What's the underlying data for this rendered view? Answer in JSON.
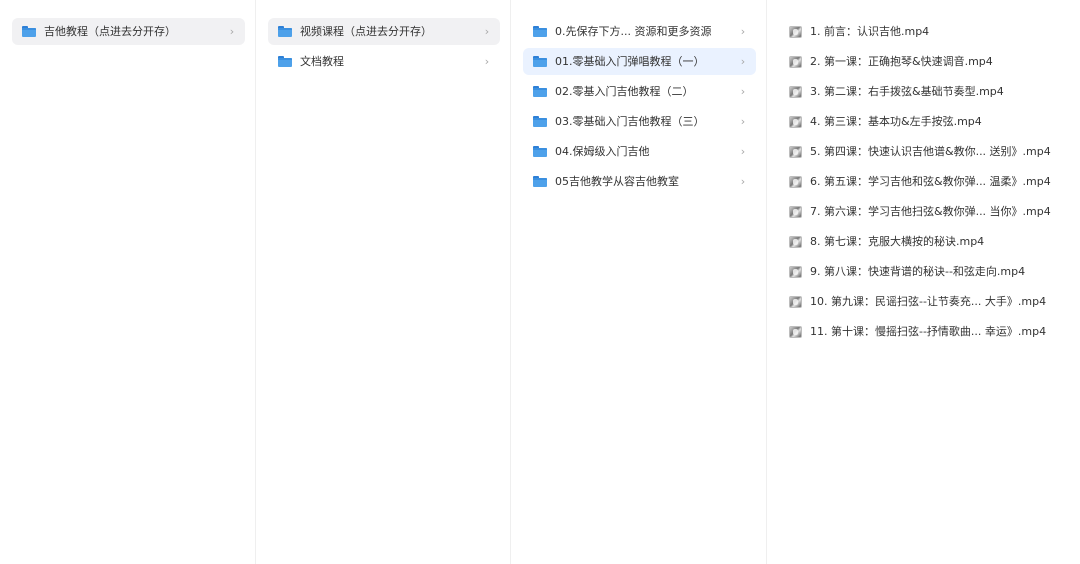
{
  "columns": [
    {
      "items": [
        {
          "label": "吉他教程（点进去分开存）",
          "icon": "folder-icon",
          "state": "selected"
        }
      ]
    },
    {
      "items": [
        {
          "label": "视频课程（点进去分开存）",
          "icon": "folder-icon",
          "state": "selected"
        },
        {
          "label": "文档教程",
          "icon": "folder-icon",
          "state": "normal"
        }
      ]
    },
    {
      "items": [
        {
          "label": "0.先保存下方... 资源和更多资源",
          "icon": "folder-icon",
          "state": "normal"
        },
        {
          "label": "01.零基础入门弹唱教程（一）",
          "icon": "folder-icon",
          "state": "active"
        },
        {
          "label": "02.零基入门吉他教程（二）",
          "icon": "folder-icon",
          "state": "normal"
        },
        {
          "label": "03.零基础入门吉他教程（三）",
          "icon": "folder-icon",
          "state": "normal"
        },
        {
          "label": "04.保姆级入门吉他",
          "icon": "folder-icon",
          "state": "normal"
        },
        {
          "label": "05吉他教学从容吉他教室",
          "icon": "folder-icon",
          "state": "normal"
        }
      ]
    },
    {
      "items": [
        {
          "label": "1. 前言：认识吉他.mp4",
          "icon": "video-thumbnail-icon"
        },
        {
          "label": "2. 第一课：正确抱琴&快速调音.mp4",
          "icon": "video-thumbnail-icon"
        },
        {
          "label": "3. 第二课：右手拨弦&基础节奏型.mp4",
          "icon": "video-thumbnail-icon"
        },
        {
          "label": "4. 第三课：基本功&左手按弦.mp4",
          "icon": "video-thumbnail-icon"
        },
        {
          "label": "5. 第四课：快速认识吉他谱&教你... 送别》.mp4",
          "icon": "video-thumbnail-icon"
        },
        {
          "label": "6. 第五课：学习吉他和弦&教你弹... 温柔》.mp4",
          "icon": "video-thumbnail-icon"
        },
        {
          "label": "7. 第六课：学习吉他扫弦&教你弹... 当你》.mp4",
          "icon": "video-thumbnail-icon"
        },
        {
          "label": "8. 第七课：克服大横按的秘诀.mp4",
          "icon": "video-thumbnail-icon"
        },
        {
          "label": "9. 第八课：快速背谱的秘诀--和弦走向.mp4",
          "icon": "video-thumbnail-icon"
        },
        {
          "label": "10. 第九课：民谣扫弦--让节奏充... 大手》.mp4",
          "icon": "video-thumbnail-icon"
        },
        {
          "label": "11. 第十课：慢摇扫弦--抒情歌曲... 幸运》.mp4",
          "icon": "video-thumbnail-icon"
        }
      ]
    }
  ],
  "chevron_glyph": "›",
  "colors": {
    "selected_bg": "#f1f1f3",
    "active_bg": "#eaf2ff",
    "folder": "#4ea1ea",
    "chevron": "#a8a8a8"
  }
}
